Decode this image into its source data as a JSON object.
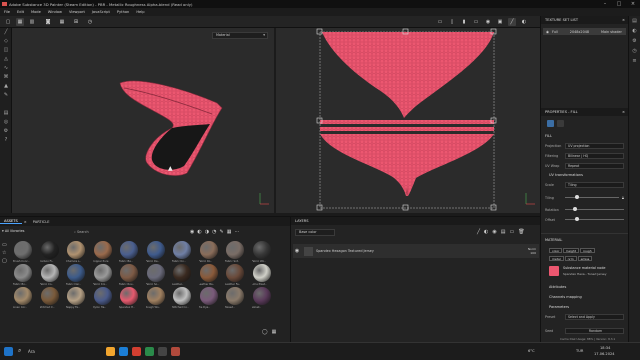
{
  "window": {
    "title": "Adobe Substance 3D Painter (Steam Edition) - PBR - Metallic Roughness Alpha-blend (Read only)"
  },
  "menu": [
    "File",
    "Edit",
    "Mode",
    "Window",
    "Viewport",
    "JavaScript",
    "Python",
    "Help"
  ],
  "viewport": {
    "material_mode": "Material"
  },
  "texture_set_list": {
    "title": "TEXTURE SET LIST",
    "row": {
      "name": "Full",
      "resolution": "2048x2048",
      "shader": "Main shader"
    }
  },
  "properties": {
    "title": "PROPERTIES - FILL",
    "section_fill": "FILL",
    "projection": {
      "label": "Projection",
      "value": "UV projection"
    },
    "filtering": {
      "label": "Filtering",
      "value": "Bilinear | HQ"
    },
    "uv_wrap": {
      "label": "UV Wrap",
      "value": "Repeat"
    },
    "uv_transform": "UV transformations",
    "scale": {
      "label": "Scale",
      "value": "Tiling"
    },
    "tiling": "Tiling",
    "rotation": "Rotation",
    "offset": "Offset",
    "section_material": "MATERIAL",
    "channels": [
      "color",
      "height",
      "rough",
      "metal",
      "nrm",
      "emiss"
    ],
    "substance_node": "Substance material node",
    "substance_name": "Spandex Hexa.. Tuned Jersey",
    "attributes": "Attributes",
    "channels_mapping": "Channels mapping",
    "parameters": "Parameters",
    "preset": {
      "label": "Preset",
      "value": "Select and Apply"
    },
    "seed": {
      "label": "Seed",
      "value": "Random"
    }
  },
  "assets": {
    "tabs": [
      "ASSETS",
      "PARTICLE"
    ],
    "all_libraries": "All libraries",
    "search_placeholder": "Search",
    "items": [
      {
        "label": "Brush Conc..",
        "color": "#6e6e6e"
      },
      {
        "label": "Carbon Fi..",
        "color": "#222222"
      },
      {
        "label": "Chamois L..",
        "color": "#b09270"
      },
      {
        "label": "Copper Pure",
        "color": "#9a6a4c"
      },
      {
        "label": "Fabric Ba..",
        "color": "#4a5f8f"
      },
      {
        "label": "Fabric De..",
        "color": "#3f5b8d"
      },
      {
        "label": "Fabric Kn..",
        "color": "#6f7fa5"
      },
      {
        "label": "Fabric Ro..",
        "color": "#8a6d5a"
      },
      {
        "label": "Fabric Sof..",
        "color": "#7a6d66"
      },
      {
        "label": "Fabric Wo..",
        "color": "#383838"
      },
      {
        "label": "Fabric Bo..",
        "color": "#8a8a8a"
      },
      {
        "label": "Fabric Co..",
        "color": "#b5b5b5"
      },
      {
        "label": "Fabric Der..",
        "color": "#3d5b8a"
      },
      {
        "label": "Fabric Kni..",
        "color": "#9a9a9a"
      },
      {
        "label": "Fabric Rou..",
        "color": "#7d5a45"
      },
      {
        "label": "Fabric So..",
        "color": "#6a6a7a"
      },
      {
        "label": "Leather..",
        "color": "#3a2a20"
      },
      {
        "label": "Leather Ba..",
        "color": "#8a5a3a"
      },
      {
        "label": "Leather Fa..",
        "color": "#6a4a3a"
      },
      {
        "label": "Lime Plast..",
        "color": "#d0d0c8"
      },
      {
        "label": "Linen Cor..",
        "color": "#a38a6a"
      },
      {
        "label": "Stitched C..",
        "color": "#7a5a3a"
      },
      {
        "label": "Nappy Fa..",
        "color": "#b5a085"
      },
      {
        "label": "Nylon Ha..",
        "color": "#4a5a8a"
      },
      {
        "label": "Spandex H..",
        "color": "#e65a6e"
      },
      {
        "label": "Rough Wo..",
        "color": "#a08060"
      },
      {
        "label": "Stitched Co..",
        "color": "#c0c0c0"
      },
      {
        "label": "Tie Dye..",
        "color": "#7a5a7a"
      },
      {
        "label": "Tweed..",
        "color": "#8a7a6a"
      },
      {
        "label": "Velvet..",
        "color": "#5a3a5a"
      }
    ]
  },
  "layers": {
    "title": "LAYERS",
    "blend": "Base color",
    "layer_name": "Spandex Hexagon Textured Jersey",
    "layer_blend": "Norm",
    "layer_opacity": "100"
  },
  "status": {
    "cache": "Cache Disk Usage: 88% | Version: 8.3.1"
  },
  "taskbar": {
    "search": "Ara",
    "temp": "6°C",
    "lang": "TUR",
    "time": "18:34",
    "date": "17.06.2024"
  }
}
